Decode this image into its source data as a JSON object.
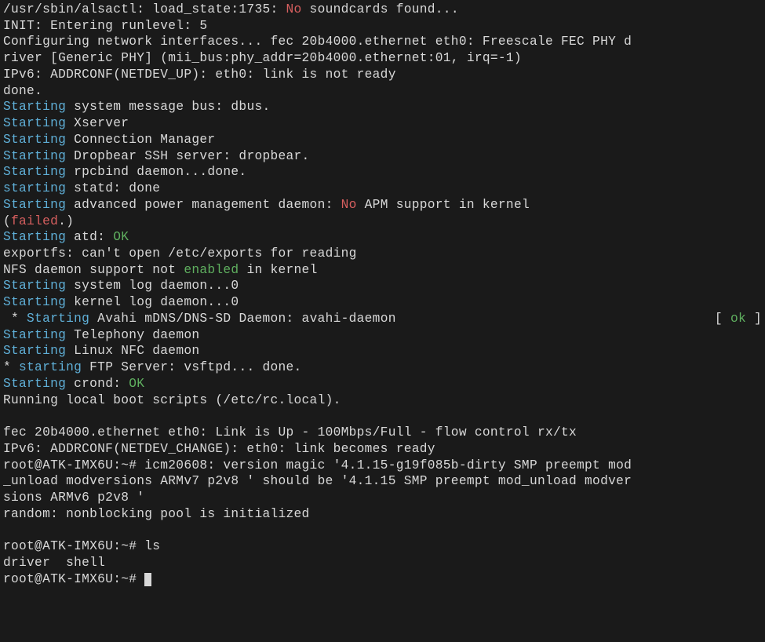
{
  "lines": [
    {
      "segments": [
        {
          "t": "/usr/sbin/alsactl: load_state:1735: ",
          "c": "white"
        },
        {
          "t": "No",
          "c": "red"
        },
        {
          "t": " soundcards found...",
          "c": "white"
        }
      ]
    },
    {
      "segments": [
        {
          "t": "INIT: Entering runlevel: 5",
          "c": "white"
        }
      ]
    },
    {
      "segments": [
        {
          "t": "Configuring network interfaces... fec 20b4000.ethernet eth0: Freescale FEC PHY d",
          "c": "white"
        }
      ]
    },
    {
      "segments": [
        {
          "t": "river [Generic PHY] (mii_bus:phy_addr=20b4000.ethernet:01, irq=-1)",
          "c": "white"
        }
      ]
    },
    {
      "segments": [
        {
          "t": "IPv6: ADDRCONF(NETDEV_UP): eth0: link is not ready",
          "c": "white"
        }
      ]
    },
    {
      "segments": [
        {
          "t": "done.",
          "c": "white"
        }
      ]
    },
    {
      "segments": [
        {
          "t": "Starting",
          "c": "cyan"
        },
        {
          "t": " system message bus: dbus.",
          "c": "white"
        }
      ]
    },
    {
      "segments": [
        {
          "t": "Starting",
          "c": "cyan"
        },
        {
          "t": " Xserver",
          "c": "white"
        }
      ]
    },
    {
      "segments": [
        {
          "t": "Starting",
          "c": "cyan"
        },
        {
          "t": " Connection Manager",
          "c": "white"
        }
      ]
    },
    {
      "segments": [
        {
          "t": "Starting",
          "c": "cyan"
        },
        {
          "t": " Dropbear SSH server: dropbear.",
          "c": "white"
        }
      ]
    },
    {
      "segments": [
        {
          "t": "Starting",
          "c": "cyan"
        },
        {
          "t": " rpcbind daemon...done.",
          "c": "white"
        }
      ]
    },
    {
      "segments": [
        {
          "t": "starting",
          "c": "cyan"
        },
        {
          "t": " statd: done",
          "c": "white"
        }
      ]
    },
    {
      "segments": [
        {
          "t": "Starting",
          "c": "cyan"
        },
        {
          "t": " advanced power management daemon: ",
          "c": "white"
        },
        {
          "t": "No",
          "c": "red"
        },
        {
          "t": " APM support in kernel",
          "c": "white"
        }
      ]
    },
    {
      "segments": [
        {
          "t": "(",
          "c": "white"
        },
        {
          "t": "failed",
          "c": "red"
        },
        {
          "t": ".)",
          "c": "white"
        }
      ]
    },
    {
      "segments": [
        {
          "t": "Starting",
          "c": "cyan"
        },
        {
          "t": " atd: ",
          "c": "white"
        },
        {
          "t": "OK",
          "c": "green"
        }
      ]
    },
    {
      "segments": [
        {
          "t": "exportfs: can't open /etc/exports for reading",
          "c": "white"
        }
      ]
    },
    {
      "segments": [
        {
          "t": "NFS daemon support not ",
          "c": "white"
        },
        {
          "t": "enabled",
          "c": "green"
        },
        {
          "t": " in kernel",
          "c": "white"
        }
      ]
    },
    {
      "segments": [
        {
          "t": "Starting",
          "c": "cyan"
        },
        {
          "t": " system log daemon...0",
          "c": "white"
        }
      ]
    },
    {
      "segments": [
        {
          "t": "Starting",
          "c": "cyan"
        },
        {
          "t": " kernel log daemon...0",
          "c": "white"
        }
      ]
    },
    {
      "segments": [
        {
          "t": " * ",
          "c": "white"
        },
        {
          "t": "Starting",
          "c": "cyan"
        },
        {
          "t": " Avahi mDNS/DNS-SD Daemon: avahi-daemon",
          "c": "white"
        }
      ],
      "status": {
        "open": "[ ",
        "label": "ok",
        "close": " ]"
      }
    },
    {
      "segments": [
        {
          "t": "Starting",
          "c": "cyan"
        },
        {
          "t": " Telephony daemon",
          "c": "white"
        }
      ]
    },
    {
      "segments": [
        {
          "t": "Starting",
          "c": "cyan"
        },
        {
          "t": " Linux NFC daemon",
          "c": "white"
        }
      ]
    },
    {
      "segments": [
        {
          "t": "* ",
          "c": "white"
        },
        {
          "t": "starting",
          "c": "cyan"
        },
        {
          "t": " FTP Server: vsftpd... done.",
          "c": "white"
        }
      ]
    },
    {
      "segments": [
        {
          "t": "Starting",
          "c": "cyan"
        },
        {
          "t": " crond: ",
          "c": "white"
        },
        {
          "t": "OK",
          "c": "green"
        }
      ]
    },
    {
      "segments": [
        {
          "t": "Running local boot scripts (/etc/rc.local).",
          "c": "white"
        }
      ]
    },
    {
      "segments": [
        {
          "t": " ",
          "c": "white"
        }
      ]
    },
    {
      "segments": [
        {
          "t": "fec 20b4000.ethernet eth0: Link is Up - 100Mbps/Full - flow control rx/tx",
          "c": "white"
        }
      ]
    },
    {
      "segments": [
        {
          "t": "IPv6: ADDRCONF(NETDEV_CHANGE): eth0: link becomes ready",
          "c": "white"
        }
      ]
    },
    {
      "segments": [
        {
          "t": "root@ATK-IMX6U:~# icm20608: version magic '4.1.15-g19f085b-dirty SMP preempt mod",
          "c": "white"
        }
      ]
    },
    {
      "segments": [
        {
          "t": "_unload modversions ARMv7 p2v8 ' should be '4.1.15 SMP preempt mod_unload modver",
          "c": "white"
        }
      ]
    },
    {
      "segments": [
        {
          "t": "sions ARMv6 p2v8 '",
          "c": "white"
        }
      ]
    },
    {
      "segments": [
        {
          "t": "random: nonblocking pool is initialized",
          "c": "white"
        }
      ]
    },
    {
      "segments": [
        {
          "t": " ",
          "c": "white"
        }
      ]
    },
    {
      "segments": [
        {
          "t": "root@ATK-IMX6U:~# ls",
          "c": "white"
        }
      ]
    },
    {
      "segments": [
        {
          "t": "driver  shell",
          "c": "white"
        }
      ]
    },
    {
      "segments": [
        {
          "t": "root@ATK-IMX6U:~# ",
          "c": "white"
        }
      ],
      "cursor": true
    }
  ]
}
